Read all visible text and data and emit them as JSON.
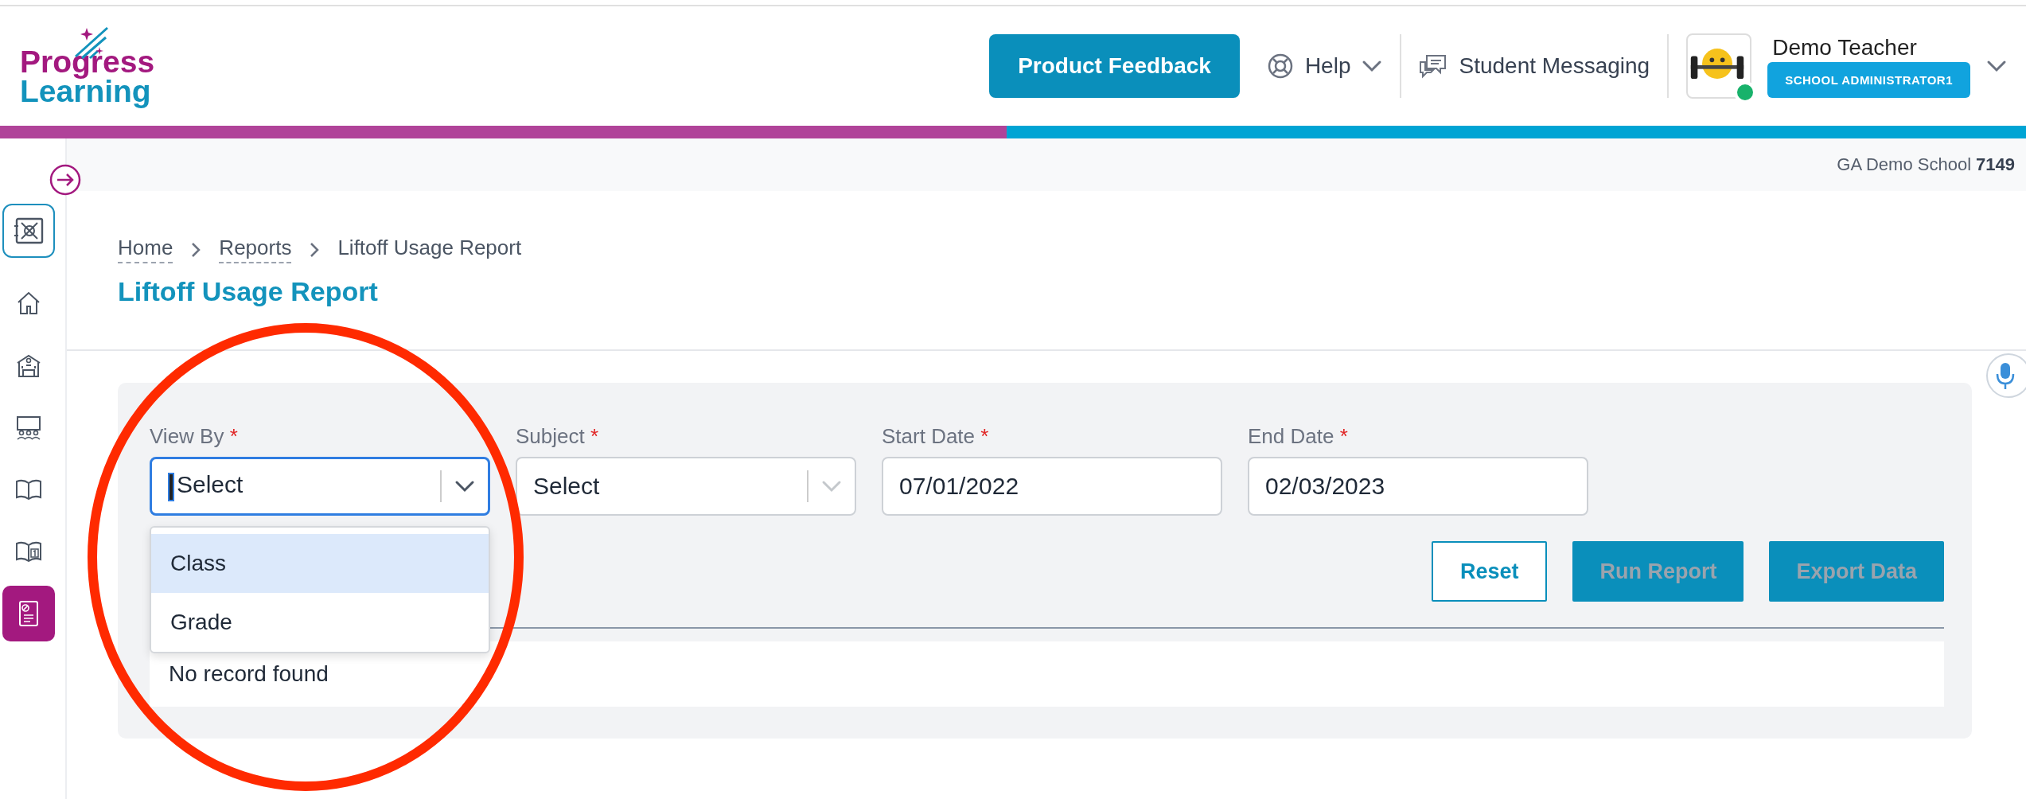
{
  "header": {
    "logo": {
      "line1": "Progress",
      "line2": "Learning"
    },
    "feedback_button": "Product Feedback",
    "help": "Help",
    "messaging": "Student Messaging",
    "user": {
      "name": "Demo Teacher",
      "role": "SCHOOL ADMINISTRATOR1",
      "online": true
    }
  },
  "school": {
    "name": "GA Demo School",
    "code": "7149"
  },
  "sidebar": {
    "items": [
      {
        "kind": "home",
        "selected": false
      },
      {
        "kind": "school",
        "selected": false
      },
      {
        "kind": "classroom",
        "selected": false
      },
      {
        "kind": "book",
        "selected": false
      },
      {
        "kind": "gradebook",
        "selected": false
      },
      {
        "kind": "report",
        "selected": true
      }
    ]
  },
  "breadcrumb": [
    {
      "label": "Home",
      "link": true
    },
    {
      "label": "Reports",
      "link": true
    },
    {
      "label": "Liftoff Usage Report",
      "link": false
    }
  ],
  "title": "Liftoff Usage Report",
  "filters": [
    {
      "kind": "select",
      "label": "View By",
      "required_mark": "*",
      "value": "Select",
      "focused": true,
      "expanded": true,
      "options": [
        {
          "label": "Class",
          "selected": true
        },
        {
          "label": "Grade",
          "selected": false
        }
      ]
    },
    {
      "kind": "select",
      "label": "Subject",
      "required_mark": "*",
      "value": "Select",
      "focused": false,
      "expanded": false
    },
    {
      "kind": "date",
      "label": "Start Date",
      "required_mark": "*",
      "value": "07/01/2022"
    },
    {
      "kind": "date",
      "label": "End Date",
      "required_mark": "*",
      "value": "02/03/2023"
    }
  ],
  "buttons": [
    {
      "kind": "outline",
      "label": "Reset",
      "disabled": false
    },
    {
      "kind": "filled",
      "label": "Run Report",
      "disabled": true
    },
    {
      "kind": "filled",
      "label": "Export Data",
      "disabled": true
    }
  ],
  "table": {
    "empty_text": "No record found"
  }
}
